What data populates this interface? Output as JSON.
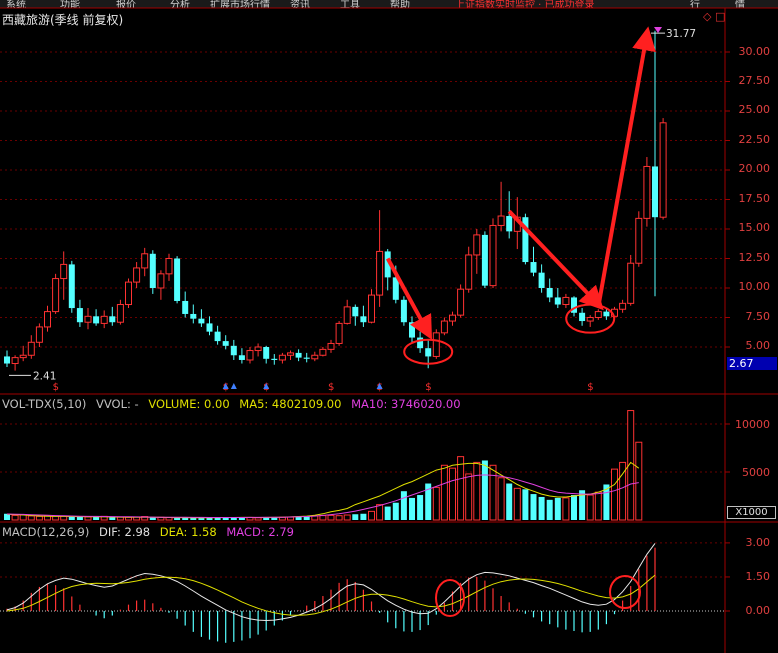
{
  "app": {
    "menu_items": [
      "系统",
      "功能",
      "报价",
      "分析",
      "扩展市场行情",
      "资讯",
      "工具",
      "帮助"
    ],
    "top_notice": "上证指数实时监控 · 已成功登录",
    "top_right": [
      "行",
      "情"
    ],
    "corner_glyph": "◇",
    "corner_glyph2": "□"
  },
  "chart_title": "西藏旅游(季线 前复权)",
  "markers": {
    "low_label": "2.41",
    "high_label": "31.77",
    "signal_glyph": "$",
    "price_box": "2.67",
    "unit_box": "X1000"
  },
  "legends": {
    "volume": [
      {
        "text": "VOL-TDX(5,10)",
        "color": "#c0c0c0"
      },
      {
        "text": "VVOL: -",
        "color": "#c0c0c0"
      },
      {
        "text": "VOLUME: 0.00",
        "color": "#e0e000"
      },
      {
        "text": "MA5: 4802109.00",
        "color": "#e0e000"
      },
      {
        "text": "MA10: 3746020.00",
        "color": "#e040e0"
      }
    ],
    "macd": [
      {
        "text": "MACD(12,26,9)",
        "color": "#c0c0c0"
      },
      {
        "text": "DIF: 2.98",
        "color": "#e0e0e0"
      },
      {
        "text": "DEA: 1.58",
        "color": "#e0e000"
      },
      {
        "text": "MACD: 2.79",
        "color": "#e040e0"
      }
    ]
  },
  "axes": {
    "price_ticks": [
      "30.00",
      "27.50",
      "25.00",
      "22.50",
      "20.00",
      "17.50",
      "15.00",
      "12.50",
      "10.00",
      "7.50",
      "5.00"
    ],
    "volume_ticks": [
      "10000",
      "5000"
    ],
    "macd_ticks": [
      "3.00",
      "1.50",
      "0.00"
    ]
  },
  "chart_data": {
    "type": "candlestick",
    "price_axis": {
      "min": 2.0,
      "max": 32.5,
      "ticks": [
        30,
        27.5,
        25,
        22.5,
        20,
        17.5,
        15,
        12.5,
        10,
        7.5,
        5
      ]
    },
    "candles": [
      [
        4.2,
        4.7,
        3.3,
        3.6
      ],
      [
        3.6,
        4.3,
        3.0,
        4.1
      ],
      [
        4.1,
        5.1,
        3.8,
        4.3
      ],
      [
        4.3,
        6.0,
        4.0,
        5.4
      ],
      [
        5.4,
        7.0,
        5.0,
        6.7
      ],
      [
        6.7,
        8.5,
        6.3,
        8.0
      ],
      [
        8.0,
        11.2,
        7.8,
        10.8
      ],
      [
        10.8,
        13.1,
        9.0,
        12.0
      ],
      [
        12.0,
        12.3,
        7.9,
        8.3
      ],
      [
        8.3,
        9.0,
        6.7,
        7.1
      ],
      [
        7.1,
        8.3,
        6.5,
        7.6
      ],
      [
        7.6,
        8.2,
        6.8,
        7.0
      ],
      [
        7.0,
        8.1,
        6.6,
        7.6
      ],
      [
        7.6,
        8.4,
        6.8,
        7.1
      ],
      [
        7.1,
        9.0,
        6.9,
        8.6
      ],
      [
        8.6,
        10.8,
        8.3,
        10.5
      ],
      [
        10.5,
        12.2,
        10.0,
        11.7
      ],
      [
        11.7,
        13.4,
        11.0,
        12.9
      ],
      [
        12.9,
        13.2,
        9.5,
        10.0
      ],
      [
        10.0,
        11.5,
        9.0,
        11.2
      ],
      [
        11.2,
        12.9,
        10.6,
        12.5
      ],
      [
        12.5,
        12.7,
        8.7,
        8.9
      ],
      [
        8.9,
        9.7,
        7.5,
        7.8
      ],
      [
        7.8,
        8.6,
        7.0,
        7.4
      ],
      [
        7.4,
        8.2,
        6.7,
        7.0
      ],
      [
        7.0,
        7.6,
        6.0,
        6.3
      ],
      [
        6.3,
        6.8,
        5.2,
        5.5
      ],
      [
        5.5,
        6.0,
        4.8,
        5.1
      ],
      [
        5.1,
        5.6,
        3.9,
        4.3
      ],
      [
        4.3,
        4.9,
        3.6,
        3.9
      ],
      [
        3.9,
        5.0,
        3.6,
        4.7
      ],
      [
        4.7,
        5.3,
        4.2,
        5.0
      ],
      [
        5.0,
        5.1,
        3.6,
        4.0
      ],
      [
        4.0,
        4.4,
        3.5,
        3.9
      ],
      [
        3.9,
        4.5,
        3.6,
        4.3
      ],
      [
        4.3,
        4.7,
        3.9,
        4.5
      ],
      [
        4.5,
        4.8,
        3.8,
        4.1
      ],
      [
        4.1,
        4.5,
        3.7,
        4.0
      ],
      [
        4.0,
        4.6,
        3.8,
        4.3
      ],
      [
        4.3,
        5.0,
        4.2,
        4.8
      ],
      [
        4.8,
        5.6,
        4.5,
        5.3
      ],
      [
        5.3,
        7.2,
        5.1,
        7.0
      ],
      [
        7.0,
        9.0,
        6.9,
        8.4
      ],
      [
        8.4,
        8.6,
        6.8,
        7.6
      ],
      [
        7.6,
        8.5,
        6.7,
        7.1
      ],
      [
        7.1,
        9.9,
        7.0,
        9.4
      ],
      [
        9.4,
        16.6,
        8.4,
        13.1
      ],
      [
        13.1,
        13.3,
        9.8,
        10.9
      ],
      [
        10.9,
        11.9,
        8.7,
        9.0
      ],
      [
        9.0,
        9.3,
        6.8,
        7.1
      ],
      [
        7.1,
        7.6,
        5.3,
        5.8
      ],
      [
        5.8,
        6.3,
        4.5,
        4.9
      ],
      [
        4.9,
        5.6,
        3.2,
        4.2
      ],
      [
        4.2,
        6.5,
        4.0,
        6.2
      ],
      [
        6.2,
        7.5,
        6.0,
        7.2
      ],
      [
        7.2,
        8.0,
        6.8,
        7.7
      ],
      [
        7.7,
        10.3,
        7.5,
        9.9
      ],
      [
        9.9,
        13.5,
        9.6,
        12.8
      ],
      [
        12.8,
        15.0,
        11.2,
        14.5
      ],
      [
        14.5,
        14.8,
        10.0,
        10.2
      ],
      [
        10.2,
        15.9,
        10.0,
        15.3
      ],
      [
        15.3,
        19.0,
        14.8,
        16.1
      ],
      [
        16.1,
        18.2,
        14.2,
        14.8
      ],
      [
        14.8,
        17.7,
        13.3,
        16.0
      ],
      [
        16.0,
        16.3,
        12.0,
        12.2
      ],
      [
        12.2,
        13.5,
        11.0,
        11.3
      ],
      [
        11.3,
        12.0,
        9.6,
        10.0
      ],
      [
        10.0,
        10.8,
        8.8,
        9.2
      ],
      [
        9.2,
        10.0,
        8.3,
        8.6
      ],
      [
        8.6,
        9.5,
        8.3,
        9.2
      ],
      [
        9.2,
        9.3,
        7.6,
        7.9
      ],
      [
        7.9,
        8.3,
        6.8,
        7.2
      ],
      [
        7.2,
        7.7,
        6.7,
        7.5
      ],
      [
        7.5,
        8.2,
        7.3,
        8.0
      ],
      [
        8.0,
        8.2,
        7.3,
        7.6
      ],
      [
        7.6,
        8.4,
        7.4,
        8.2
      ],
      [
        8.2,
        9.0,
        7.9,
        8.7
      ],
      [
        8.7,
        12.8,
        8.5,
        12.1
      ],
      [
        12.1,
        16.5,
        11.8,
        15.9
      ],
      [
        15.9,
        21.1,
        15.2,
        20.3
      ],
      [
        20.3,
        31.8,
        9.3,
        16.0
      ],
      [
        16.0,
        24.4,
        15.8,
        24.0
      ]
    ],
    "volume": [
      650,
      480,
      550,
      420,
      380,
      470,
      420,
      400,
      380,
      350,
      320,
      360,
      380,
      340,
      300,
      280,
      310,
      360,
      300,
      280,
      260,
      240,
      220,
      230,
      200,
      210,
      230,
      260,
      280,
      300,
      260,
      230,
      220,
      250,
      280,
      300,
      330,
      380,
      420,
      460,
      480,
      450,
      520,
      600,
      650,
      900,
      1600,
      1400,
      1800,
      3000,
      2300,
      2600,
      3800,
      3400,
      5700,
      5400,
      6600,
      4800,
      6000,
      6200,
      5700,
      4400,
      3800,
      3300,
      3200,
      2700,
      2400,
      2100,
      2300,
      2300,
      2600,
      3100,
      2600,
      2900,
      3700,
      5300,
      6000,
      11400,
      8100
    ],
    "vol_ma5": [
      600,
      560,
      520,
      470,
      420,
      400,
      380,
      370,
      360,
      350,
      340,
      330,
      320,
      310,
      300,
      290,
      280,
      280,
      280,
      270,
      260,
      250,
      245,
      240,
      235,
      240,
      250,
      260,
      265,
      270,
      270,
      265,
      260,
      270,
      290,
      320,
      360,
      410,
      500,
      650,
      850,
      1000,
      1200,
      1600,
      1900,
      2200,
      2500,
      2900,
      3300,
      3700,
      4000,
      4400,
      4800,
      5200,
      5400,
      5700,
      5800,
      5900,
      5900,
      5700,
      5200,
      4700,
      4200,
      3700,
      3300,
      3000,
      2700,
      2500,
      2400,
      2400,
      2500,
      2600,
      2700,
      2900,
      3200,
      3700,
      4800,
      6000,
      5400
    ],
    "vol_ma10": [
      620,
      600,
      580,
      550,
      520,
      490,
      460,
      440,
      420,
      400,
      380,
      370,
      360,
      350,
      340,
      330,
      320,
      310,
      300,
      295,
      290,
      285,
      280,
      275,
      270,
      265,
      265,
      265,
      265,
      265,
      268,
      272,
      278,
      285,
      295,
      310,
      330,
      360,
      410,
      480,
      560,
      660,
      780,
      930,
      1100,
      1300,
      1500,
      1750,
      2000,
      2300,
      2600,
      2900,
      3200,
      3500,
      3800,
      4100,
      4300,
      4500,
      4650,
      4700,
      4650,
      4550,
      4400,
      4200,
      3950,
      3700,
      3400,
      3100,
      2900,
      2800,
      2750,
      2700,
      2700,
      2750,
      2850,
      3050,
      3350,
      3750,
      3900
    ],
    "macd": {
      "dif": [
        0.05,
        0.15,
        0.35,
        0.65,
        0.95,
        1.2,
        1.35,
        1.45,
        1.4,
        1.3,
        1.2,
        1.12,
        1.05,
        1.1,
        1.25,
        1.4,
        1.55,
        1.65,
        1.62,
        1.55,
        1.45,
        1.3,
        1.1,
        0.88,
        0.65,
        0.45,
        0.25,
        0.05,
        -0.1,
        -0.25,
        -0.35,
        -0.4,
        -0.42,
        -0.4,
        -0.35,
        -0.28,
        -0.18,
        -0.05,
        0.1,
        0.3,
        0.55,
        0.85,
        1.1,
        1.2,
        1.15,
        0.95,
        0.7,
        0.45,
        0.25,
        0.08,
        -0.05,
        -0.12,
        -0.1,
        0.1,
        0.4,
        0.75,
        1.1,
        1.4,
        1.6,
        1.7,
        1.68,
        1.62,
        1.55,
        1.45,
        1.35,
        1.25,
        1.12,
        1.0,
        0.85,
        0.7,
        0.55,
        0.4,
        0.3,
        0.25,
        0.3,
        0.5,
        0.85,
        1.3,
        1.9,
        2.5,
        2.98
      ],
      "dea": [
        0.0,
        0.05,
        0.12,
        0.25,
        0.42,
        0.6,
        0.78,
        0.95,
        1.08,
        1.16,
        1.2,
        1.22,
        1.21,
        1.2,
        1.22,
        1.26,
        1.32,
        1.4,
        1.45,
        1.48,
        1.49,
        1.47,
        1.42,
        1.34,
        1.22,
        1.08,
        0.92,
        0.75,
        0.58,
        0.4,
        0.25,
        0.12,
        0.01,
        -0.08,
        -0.14,
        -0.18,
        -0.19,
        -0.17,
        -0.12,
        -0.03,
        0.08,
        0.23,
        0.4,
        0.56,
        0.68,
        0.74,
        0.74,
        0.7,
        0.63,
        0.53,
        0.41,
        0.3,
        0.21,
        0.18,
        0.22,
        0.32,
        0.48,
        0.66,
        0.85,
        1.03,
        1.18,
        1.29,
        1.36,
        1.4,
        1.41,
        1.39,
        1.35,
        1.29,
        1.21,
        1.11,
        0.99,
        0.87,
        0.76,
        0.66,
        0.59,
        0.57,
        0.62,
        0.75,
        0.98,
        1.28,
        1.58
      ],
      "hist": [
        0.1,
        0.2,
        0.46,
        0.8,
        1.06,
        1.2,
        1.14,
        1.0,
        0.64,
        0.28,
        0.0,
        -0.2,
        -0.32,
        -0.2,
        0.06,
        0.28,
        0.46,
        0.5,
        0.34,
        0.14,
        -0.08,
        -0.34,
        -0.64,
        -0.92,
        -1.14,
        -1.26,
        -1.34,
        -1.4,
        -1.36,
        -1.3,
        -1.2,
        -1.04,
        -0.86,
        -0.64,
        -0.42,
        -0.2,
        0.02,
        0.24,
        0.44,
        0.66,
        0.94,
        1.24,
        1.4,
        1.28,
        0.94,
        0.42,
        -0.08,
        -0.5,
        -0.76,
        -0.9,
        -0.92,
        -0.84,
        -0.62,
        -0.16,
        0.36,
        0.86,
        1.24,
        1.48,
        1.5,
        1.34,
        1.0,
        0.66,
        0.38,
        0.1,
        -0.12,
        -0.28,
        -0.46,
        -0.58,
        -0.72,
        -0.82,
        -0.88,
        -0.94,
        -0.92,
        -0.82,
        -0.58,
        -0.14,
        0.46,
        1.1,
        1.84,
        2.44,
        2.79
      ]
    }
  }
}
